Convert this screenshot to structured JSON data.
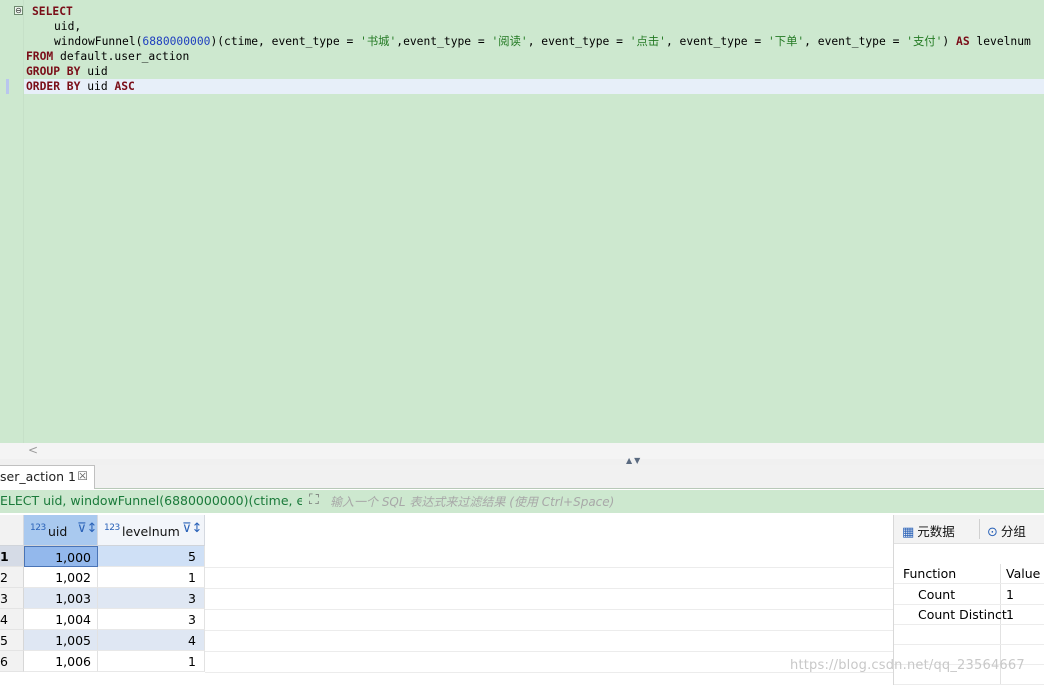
{
  "editor": {
    "fold_symbol": "⊖",
    "sql": {
      "kw_select": "SELECT",
      "col_uid": "uid,",
      "fn_name": "windowFunnel(",
      "window": "6880000000",
      "fn_rest_a": ")(ctime, event_type = ",
      "s1": "'书城'",
      "fn_rest_b": ",event_type = ",
      "s2": "'阅读'",
      "fn_rest_c": ", event_type = ",
      "s3": "'点击'",
      "fn_rest_d": ", event_type = ",
      "s4": "'下单'",
      "fn_rest_e": ", event_type = ",
      "s5": "'支付'",
      "fn_rest_f": ") ",
      "kw_as": "AS",
      "alias": " levelnum",
      "kw_from": "FROM",
      "table": " default.user_action",
      "kw_group": "GROUP BY",
      "group_col": " uid",
      "kw_order": "ORDER BY",
      "order_col": " uid ",
      "kw_asc": "ASC"
    },
    "scroll_left": "<",
    "split_arrows": "▲▼"
  },
  "results": {
    "tab_label": "ser_action 1",
    "tab_close": "☒",
    "filter_query": "ELECT uid, windowFunnel(6880000000)(ctime, event_",
    "filter_icon": "⛶",
    "filter_placeholder": "输入一个 SQL 表达式来过滤结果 (使用 Ctrl+Space)",
    "columns": [
      {
        "type_icon": "123",
        "name": "uid",
        "sort_icon": "⊽↕"
      },
      {
        "type_icon": "123",
        "name": "levelnum",
        "sort_icon": "⊽↕"
      }
    ],
    "rows": [
      {
        "n": "1",
        "uid": "1,000",
        "levelnum": "5"
      },
      {
        "n": "2",
        "uid": "1,002",
        "levelnum": "1"
      },
      {
        "n": "3",
        "uid": "1,003",
        "levelnum": "3"
      },
      {
        "n": "4",
        "uid": "1,004",
        "levelnum": "3"
      },
      {
        "n": "5",
        "uid": "1,005",
        "levelnum": "4"
      },
      {
        "n": "6",
        "uid": "1,006",
        "levelnum": "1"
      }
    ]
  },
  "panel": {
    "tab_meta": "元数据",
    "tab_meta_icon": "▦",
    "tab_group": "分组",
    "tab_group_icon": "⊙",
    "header_function": "Function",
    "header_value": "Value",
    "stats": [
      {
        "func": "Count",
        "value": "1"
      },
      {
        "func": "Count Distinct",
        "value": "1"
      }
    ]
  },
  "watermark": "https://blog.csdn.net/qq_23564667"
}
